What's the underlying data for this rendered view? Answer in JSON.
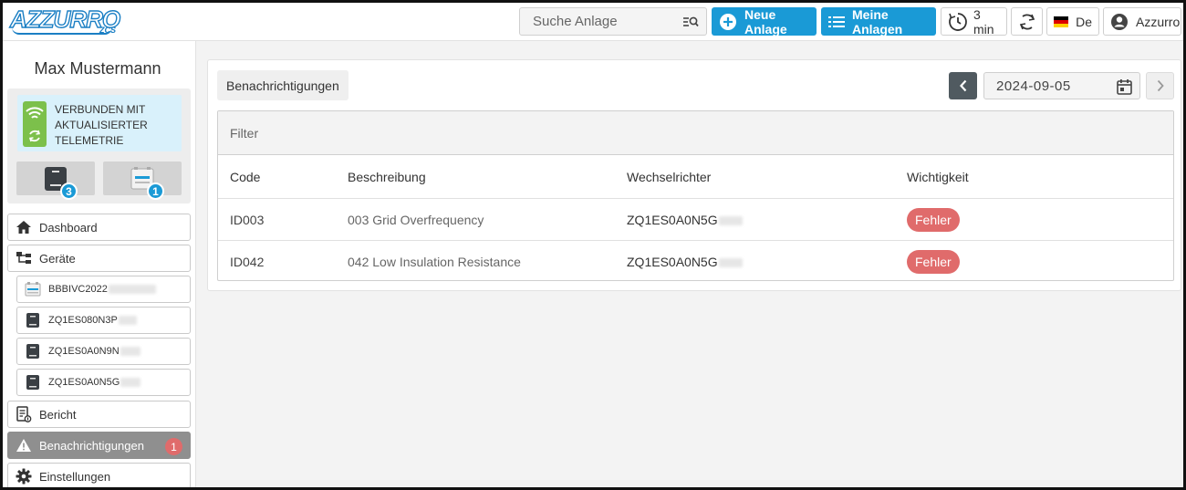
{
  "header": {
    "logo_text": "AZZURRO",
    "logo_sub": "ZCS",
    "search_placeholder": "Suche Anlage",
    "new_plant_label": "Neue Anlage",
    "my_plants_label": "Meine Anlagen",
    "refresh_interval": "3 min",
    "language": "De",
    "user_label": "Azzurro"
  },
  "sidebar": {
    "user_name": "Max Mustermann",
    "connection_status": [
      "VERBUNDEN MIT",
      "AKTUALISIERTER",
      "TELEMETRIE"
    ],
    "inverter_count": "3",
    "datalogger_count": "1",
    "items": [
      {
        "label": "Dashboard",
        "icon": "home-icon"
      },
      {
        "label": "Geräte",
        "icon": "devices-tree-icon"
      },
      {
        "label": "BBBIVC2022",
        "icon": "datalogger-icon",
        "sub": true
      },
      {
        "label": "ZQ1ES080N3P",
        "icon": "inverter-icon",
        "sub": true
      },
      {
        "label": "ZQ1ES0A0N9N",
        "icon": "inverter-icon",
        "sub": true
      },
      {
        "label": "ZQ1ES0A0N5G",
        "icon": "inverter-icon",
        "sub": true
      },
      {
        "label": "Bericht",
        "icon": "report-icon"
      },
      {
        "label": "Benachrichtigungen",
        "icon": "warning-icon",
        "active": true,
        "badge": "1"
      },
      {
        "label": "Einstellungen",
        "icon": "gear-icon"
      }
    ]
  },
  "main": {
    "title": "Benachrichtigungen",
    "date": "2024-09-05",
    "filter_placeholder": "Filter",
    "columns": [
      "Code",
      "Beschreibung",
      "Wechselrichter",
      "Wichtigkeit"
    ],
    "rows": [
      {
        "code": "ID003",
        "description": "003 Grid Overfrequency",
        "inverter": "ZQ1ES0A0N5G",
        "severity": "Fehler"
      },
      {
        "code": "ID042",
        "description": "042 Low Insulation Resistance",
        "inverter": "ZQ1ES0A0N5G",
        "severity": "Fehler"
      }
    ]
  },
  "colors": {
    "accent": "#1a9ad6",
    "error": "#e06b6b",
    "connected_bg": "#d9f1fb",
    "connected_badge": "#7cc04b"
  }
}
